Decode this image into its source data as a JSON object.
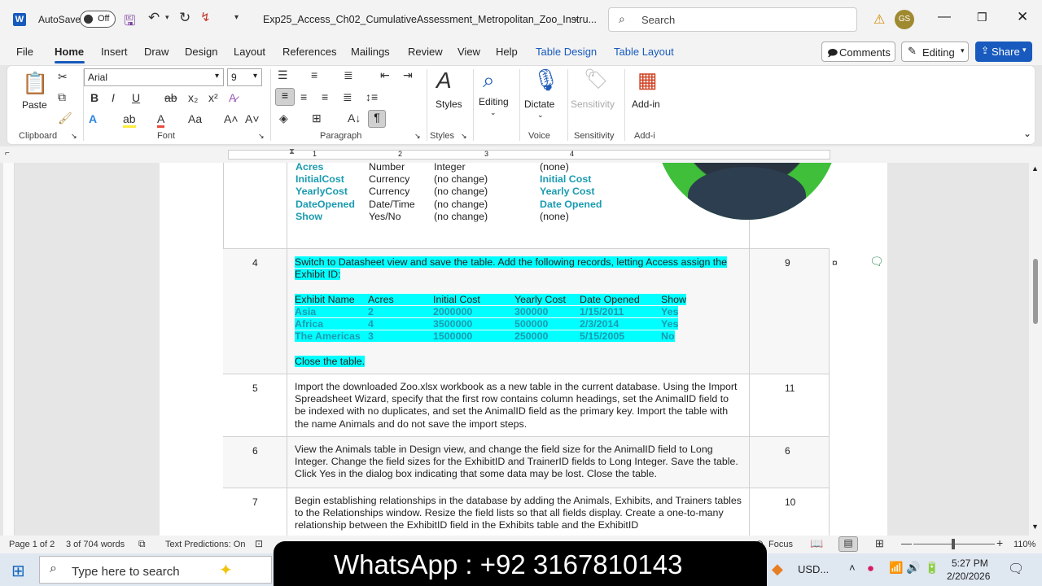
{
  "titlebar": {
    "autosave_label": "AutoSave",
    "autosave_state": "Off",
    "doc_title": "Exp25_Access_Ch02_CumulativeAssessment_Metropolitan_Zoo_Instru...",
    "search_placeholder": "Search",
    "avatar_initials": "GS"
  },
  "menu": [
    "File",
    "Home",
    "Insert",
    "Draw",
    "Design",
    "Layout",
    "References",
    "Mailings",
    "Review",
    "View",
    "Help",
    "Table Design",
    "Table Layout"
  ],
  "buttons": {
    "comments": "Comments",
    "editing": "Editing",
    "share": "Share"
  },
  "ribbon": {
    "paste": "Paste",
    "font_name": "Arial",
    "font_size": "9",
    "styles": "Styles",
    "editing": "Editing",
    "dictate": "Dictate",
    "sensitivity": "Sensitivity",
    "addin": "Add-in",
    "groups": {
      "clipboard": "Clipboard",
      "font": "Font",
      "paragraph": "Paragraph",
      "styles": "Styles",
      "voice": "Voice",
      "sensitivity": "Sensitivity",
      "addins": "Add-i"
    }
  },
  "ruler_nums": [
    "1",
    "2",
    "3",
    "4"
  ],
  "doc": {
    "top_fields": [
      {
        "name": "Acres",
        "type": "Number",
        "change": "Integer",
        "caption": "(none)"
      },
      {
        "name": "InitialCost",
        "type": "Currency",
        "change": "(no change)",
        "caption": "Initial Cost"
      },
      {
        "name": "YearlyCost",
        "type": "Currency",
        "change": "(no change)",
        "caption": "Yearly Cost"
      },
      {
        "name": "DateOpened",
        "type": "Date/Time",
        "change": "(no change)",
        "caption": "Date Opened"
      },
      {
        "name": "Show",
        "type": "Yes/No",
        "change": "(no change)",
        "caption": "(none)"
      }
    ],
    "row4": {
      "num": "4",
      "points": "9",
      "intro": "Switch to Datasheet view and save the table. Add the following records, letting Access assign the Exhibit ID:",
      "headers": [
        "Exhibit Name",
        "Acres",
        "Initial Cost",
        "Yearly Cost",
        "Date Opened",
        "Show"
      ],
      "records": [
        [
          "Asia",
          "2",
          "2000000",
          "300000",
          "1/15/2011",
          "Yes"
        ],
        [
          "Africa",
          "4",
          "3500000",
          "500000",
          "2/3/2014",
          "Yes"
        ],
        [
          "The Americas",
          "3",
          "1500000",
          "250000",
          "5/15/2005",
          "No"
        ]
      ],
      "close": "Close the table."
    },
    "row5": {
      "num": "5",
      "points": "11",
      "text": "Import the downloaded Zoo.xlsx workbook as a new table in the current database. Using the Import Spreadsheet Wizard, specify that the first row contains column headings, set the AnimalID field to be indexed with no duplicates, and set the AnimalID field as the primary key. Import the table with the name Animals and do not save the import steps."
    },
    "row6": {
      "num": "6",
      "points": "6",
      "text": "View the Animals table in Design view, and change the field size for the AnimalID field to Long Integer. Change the field sizes for the ExhibitID and TrainerID fields to Long Integer. Save the table. Click Yes in the dialog box indicating that some data may be lost. Close the table."
    },
    "row7": {
      "num": "7",
      "points": "10",
      "text": "Begin establishing relationships in the database by adding the Animals, Exhibits, and Trainers tables to the Relationships window. Resize the field lists so that all fields display. Create a one-to-many relationship between the ExhibitID field in the Exhibits table and the ExhibitID"
    }
  },
  "status": {
    "page": "Page 1 of 2",
    "words": "3 of 704 words",
    "predictions": "Text Predictions: On",
    "focus": "Focus",
    "zoom": "110%"
  },
  "taskbar": {
    "search": "Type here to search",
    "banner": "WhatsApp : +92 3167810143",
    "currency": "USD...",
    "time": "5:27 PM",
    "date": "2/20/2026"
  }
}
